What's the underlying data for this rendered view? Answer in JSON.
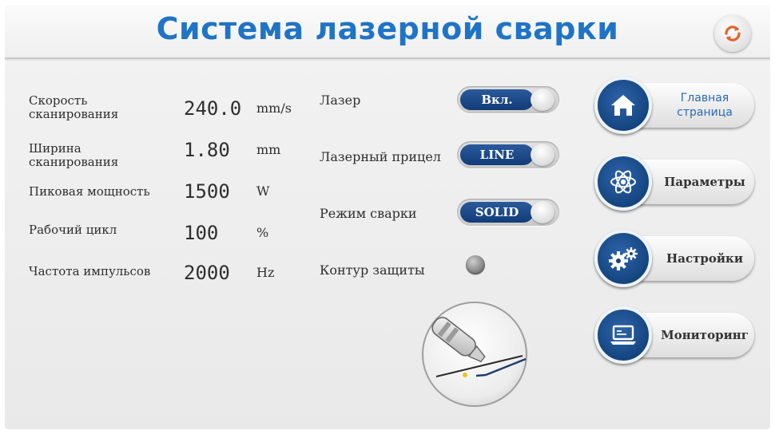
{
  "header": {
    "title": "Система лазерной сварки",
    "refresh_icon": "refresh-icon",
    "accent_color": "#1f74c6",
    "refresh_color": "#e8612a"
  },
  "params": [
    {
      "label": "Скорость\nсканирования",
      "value": "240.0",
      "unit": "mm/s"
    },
    {
      "label": "Ширина\nсканирования",
      "value": "1.80",
      "unit": "mm"
    },
    {
      "label": "Пиковая мощность",
      "value": "1500",
      "unit": "W"
    },
    {
      "label": "Рабочий цикл",
      "value": "100",
      "unit": "%"
    },
    {
      "label": "Частота импульсов",
      "value": "2000",
      "unit": "Hz"
    }
  ],
  "controls": {
    "laser": {
      "label": "Лазер",
      "state": "Вкл."
    },
    "aiming": {
      "label": "Лазерный прицел",
      "state": "LINE"
    },
    "mode": {
      "label": "Режим сварки",
      "state": "SOLID"
    },
    "protection": {
      "label": "Контур защиты",
      "indicator": "off"
    }
  },
  "nav": [
    {
      "label": "Главная\nстраница",
      "icon": "home-icon"
    },
    {
      "label": "Параметры",
      "icon": "atom-icon"
    },
    {
      "label": "Настройки",
      "icon": "gears-icon"
    },
    {
      "label": "Мониторинг",
      "icon": "laptop-icon"
    }
  ],
  "colors": {
    "toggle_active": "#123c78",
    "nav_icon_bg": "#14457f",
    "home_text": "#2a68b8"
  }
}
